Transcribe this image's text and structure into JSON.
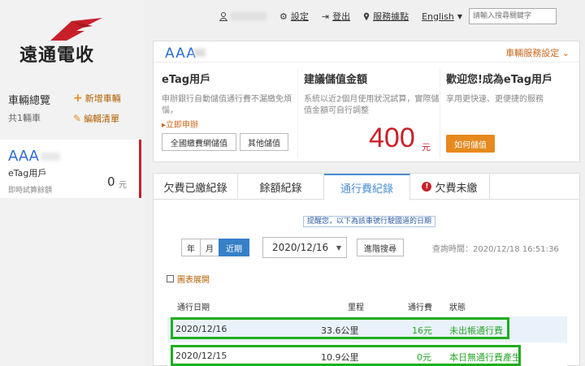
{
  "brand": {
    "logo_text": "遠通電收",
    "accent": "#c8202a",
    "link_color": "#b35f00"
  },
  "sidebar": {
    "title": "車輛總覽",
    "count": "共1輛車",
    "add_label": "新增車輛",
    "edit_label": "編輯清單",
    "vehicle": {
      "plate": "AAA",
      "type": "eTag用戶",
      "sub": "即時試算餘額",
      "amount": "0",
      "unit": "元"
    }
  },
  "topnav": {
    "user_icon": "user-icon",
    "settings_label": "設定",
    "logout_label": "登出",
    "service_label": "服務據點",
    "language": "English",
    "search_placeholder": "請輸入搜尋關鍵字"
  },
  "info": {
    "plate": "AAA",
    "service_link": "車輛服務設定",
    "col1": {
      "title": "eTag用戶",
      "desc": "申辦銀行自動儲值通行費不漏繳免煩惱，",
      "apply": "▸立即申辦",
      "btn1": "全國繳費網儲值",
      "btn2": "其他儲值"
    },
    "col2": {
      "title": "建議儲值金額",
      "desc": "系統以近2個月使用狀況試算，實際儲值金額可自行調整",
      "amount": "400",
      "unit": "元"
    },
    "col3": {
      "title": "歡迎您!成為eTag用戶",
      "desc": "享用更快速、更便捷的服務",
      "btn": "如何儲值"
    }
  },
  "tabs": [
    {
      "label": "欠費已繳紀錄"
    },
    {
      "label": "餘額紀錄"
    },
    {
      "label": "通行費紀錄"
    },
    {
      "label": "欠費未繳"
    }
  ],
  "records": {
    "hint": "提醒您，以下為該車號行駛國道的日期",
    "seg": [
      "年",
      "月",
      "近期"
    ],
    "date": "2020/12/16",
    "adv_search": "進階搜尋",
    "query_time": "查詢時間：2020/12/18 16:51:36",
    "chart_toggle": "圖表展開",
    "columns": [
      "通行日期",
      "里程",
      "通行費",
      "狀態"
    ],
    "rows": [
      {
        "date": "2020/12/16",
        "mileage": "33.6公里",
        "fee": "16元",
        "status": "未出帳通行費"
      },
      {
        "date": "2020/12/15",
        "mileage": "10.9公里",
        "fee": "0元",
        "status": "本日無通行費產生"
      }
    ]
  }
}
